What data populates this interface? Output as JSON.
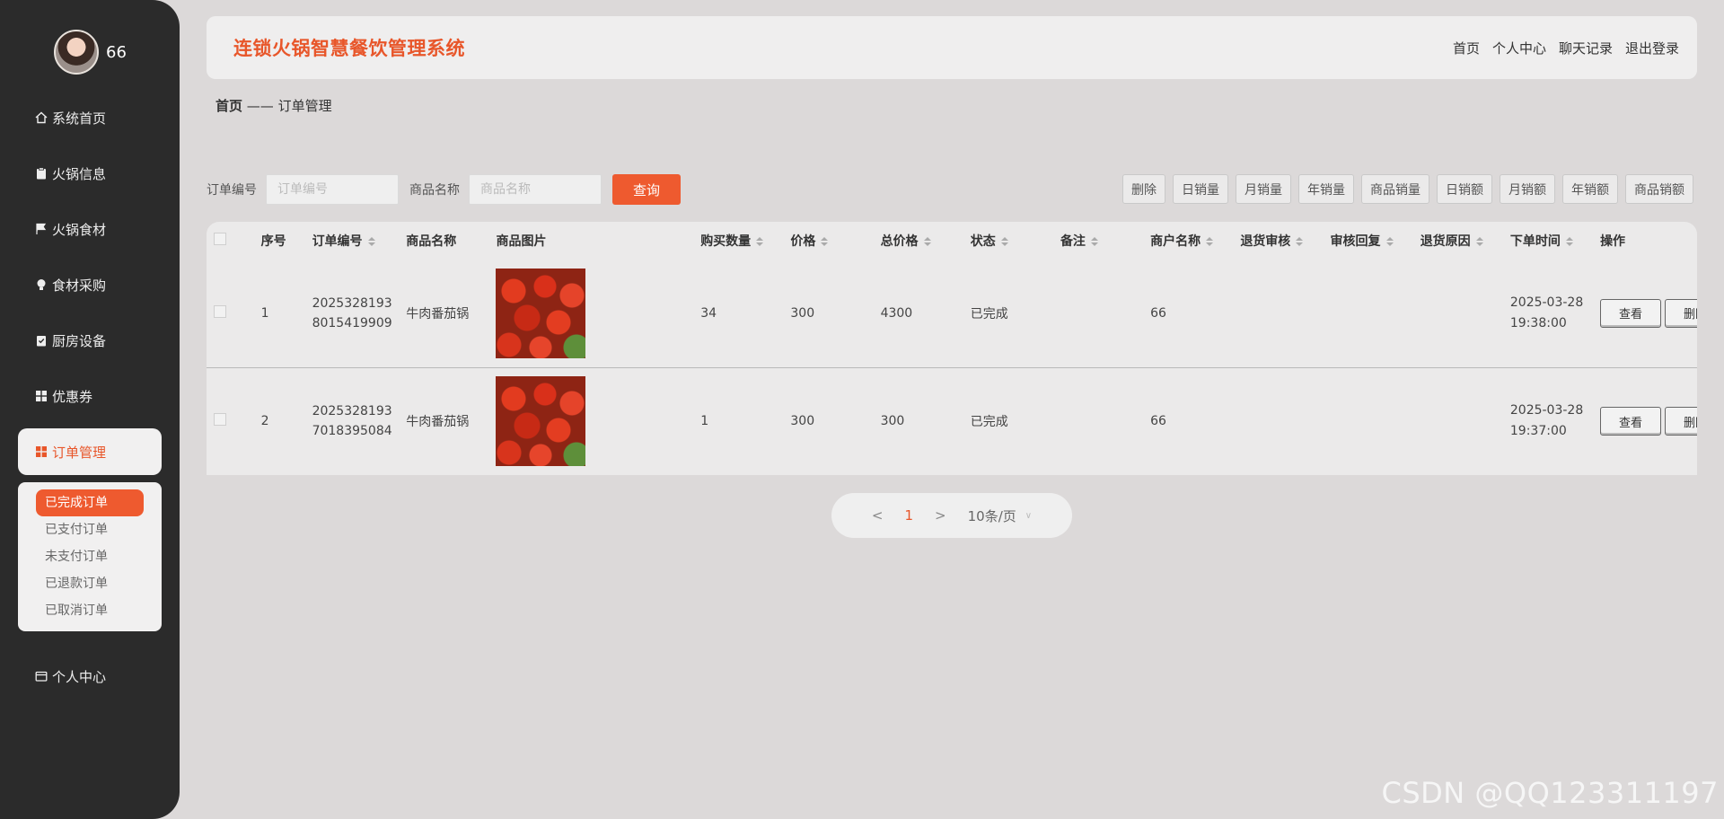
{
  "user": {
    "name": "66"
  },
  "sidebar": {
    "items": [
      {
        "label": "系统首页",
        "icon": "home-icon"
      },
      {
        "label": "火锅信息",
        "icon": "clipboard-icon"
      },
      {
        "label": "火锅食材",
        "icon": "flag-icon"
      },
      {
        "label": "食材采购",
        "icon": "bulb-icon"
      },
      {
        "label": "厨房设备",
        "icon": "checklist-icon"
      },
      {
        "label": "优惠券",
        "icon": "grid-icon"
      },
      {
        "label": "订单管理",
        "icon": "grid-icon",
        "active": true
      },
      {
        "label": "个人中心",
        "icon": "wallet-icon"
      }
    ],
    "submenu": [
      "已完成订单",
      "已支付订单",
      "未支付订单",
      "已退款订单",
      "已取消订单"
    ]
  },
  "header": {
    "title": "连锁火锅智慧餐饮管理系统",
    "nav": [
      "首页",
      "个人中心",
      "聊天记录",
      "退出登录"
    ]
  },
  "breadcrumb": {
    "home": "首页",
    "separator": "——",
    "current": "订单管理"
  },
  "search": {
    "order_label": "订单编号",
    "order_placeholder": "订单编号",
    "product_label": "商品名称",
    "product_placeholder": "商品名称",
    "query_button": "查询"
  },
  "actions": [
    "删除",
    "日销量",
    "月销量",
    "年销量",
    "商品销量",
    "日销额",
    "月销额",
    "年销额",
    "商品销额"
  ],
  "table": {
    "headers": [
      "序号",
      "订单编号",
      "商品名称",
      "商品图片",
      "购买数量",
      "价格",
      "总价格",
      "状态",
      "备注",
      "商户名称",
      "退货审核",
      "审核回复",
      "退货原因",
      "下单时间",
      "操作"
    ],
    "rows": [
      {
        "index": "1",
        "order_no": "20253281938015419909",
        "product": "牛肉番茄锅",
        "qty": "34",
        "price": "300",
        "total": "4300",
        "status": "已完成",
        "note": "",
        "merchant": "66",
        "return_review": "",
        "review_reply": "",
        "return_reason": "",
        "date": "2025-03-28",
        "time": "19:38:00",
        "view_label": "查看",
        "delete_label": "删除"
      },
      {
        "index": "2",
        "order_no": "20253281937018395084",
        "product": "牛肉番茄锅",
        "qty": "1",
        "price": "300",
        "total": "300",
        "status": "已完成",
        "note": "",
        "merchant": "66",
        "return_review": "",
        "review_reply": "",
        "return_reason": "",
        "date": "2025-03-28",
        "time": "19:37:00",
        "view_label": "查看",
        "delete_label": "删除"
      }
    ]
  },
  "pagination": {
    "prev": "<",
    "current": "1",
    "next": ">",
    "page_size": "10条/页"
  },
  "watermark": "CSDN @QQ123311197",
  "colors": {
    "accent": "#ee5a2f",
    "sidebar_bg": "#2b2b2b",
    "page_bg": "#dcd9d9"
  }
}
